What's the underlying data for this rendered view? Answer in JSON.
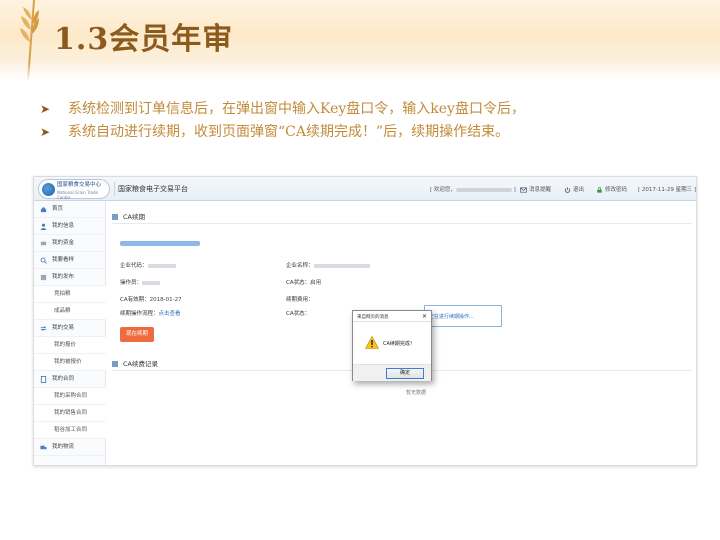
{
  "slide": {
    "title": "1.3会员年审",
    "bullets": [
      "系统检测到订单信息后，在弹出窗中输入Key盘口令，输入key盘口令后，",
      "系统自动进行续期，收到页面弹窗“CA续期完成！”后，续期操作结束。"
    ]
  },
  "app": {
    "logo_title": "国家粮食交易中心",
    "logo_subtitle": "National Grain Trade Center",
    "platform_name": "国家粮食电子交易平台",
    "welcome": "[ 欢迎您，",
    "welcome_end": " ]",
    "messages": "消息提醒",
    "logout": "退出",
    "change_password": "修改密码",
    "date": "[ 2017-11-29 星期三 ]",
    "colors": {
      "accent": "#2a6fc0",
      "renew_button": "#ef6a3f",
      "slide_title": "#8c5a1c",
      "bullet_text": "#c28b3a"
    }
  },
  "sidebar": {
    "items": [
      {
        "label": "首页",
        "icon": "home-icon"
      },
      {
        "label": "我的信息",
        "icon": "user-icon"
      },
      {
        "label": "我的资金",
        "icon": "money-icon"
      },
      {
        "label": "我要看样",
        "icon": "sample-icon"
      },
      {
        "label": "我的发布",
        "icon": "publish-icon"
      },
      {
        "label": "竞拍粮",
        "sub": true
      },
      {
        "label": "成品粮",
        "sub": true
      },
      {
        "label": "我的交易",
        "icon": "trade-icon"
      },
      {
        "label": "我的报价",
        "sub": true
      },
      {
        "label": "我的被报价",
        "sub": true
      },
      {
        "label": "我的合同",
        "icon": "contract-icon"
      },
      {
        "label": "我的采购合同",
        "sub": true
      },
      {
        "label": "我的销售合同",
        "sub": true
      },
      {
        "label": "稻谷加工合同",
        "sub": true
      },
      {
        "label": "我的物流",
        "icon": "logistics-icon"
      }
    ]
  },
  "ca_renewal": {
    "section_title": "CA续期",
    "company_code_label": "企业代码：",
    "company_name_label": "企业名称：",
    "operator_label": "操作员：",
    "ca_status_label": "CA状态：",
    "ca_status_value": "启用",
    "ca_expiry_label": "CA有效期：",
    "ca_expiry_value": "2018-01-27",
    "renew_fee_label": "续期费用：",
    "renew_process_label": "续期操作流程：",
    "renew_process_link": "点击查看",
    "ca_status2_label": "CA状态：",
    "ongoing_text": "正在进行续期操作...",
    "renew_button": "现在续期"
  },
  "records": {
    "section_title": "CA续费记录",
    "empty_text": "暂无数据"
  },
  "dialog": {
    "title": "来自网页的消息",
    "close": "✕",
    "message": "CA续期完成！",
    "ok_button": "确定"
  }
}
